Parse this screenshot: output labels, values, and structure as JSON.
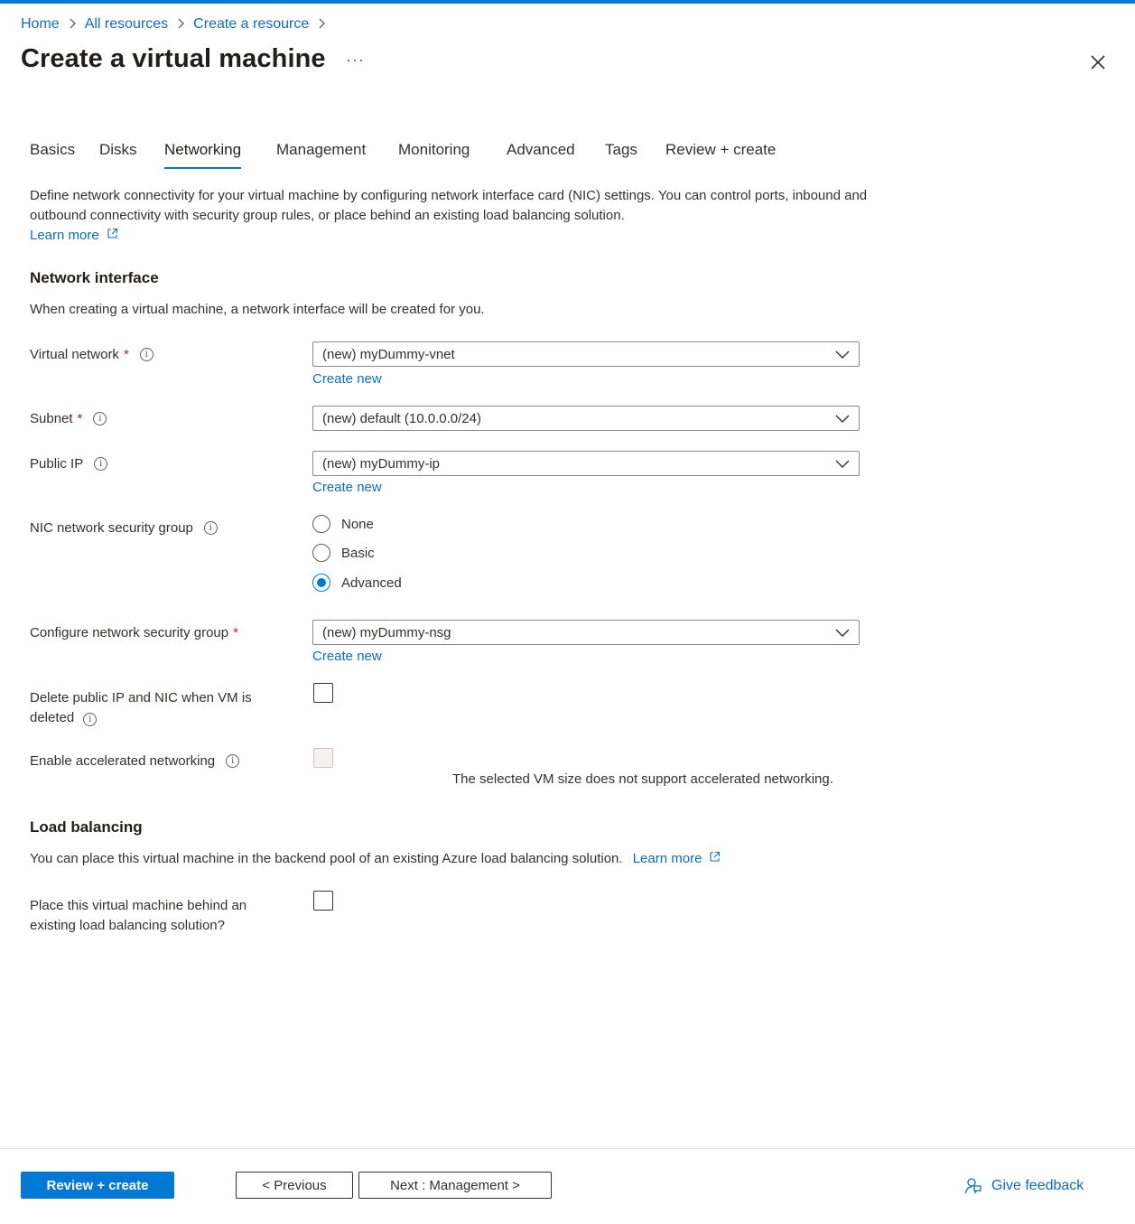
{
  "breadcrumb": [
    "Home",
    "All resources",
    "Create a resource"
  ],
  "page_title": "Create a virtual machine",
  "more_label": "···",
  "tabs": [
    "Basics",
    "Disks",
    "Networking",
    "Management",
    "Monitoring",
    "Advanced",
    "Tags",
    "Review + create"
  ],
  "active_tab": "Networking",
  "intro": {
    "text": "Define network connectivity for your virtual machine by configuring network interface card (NIC) settings. You can control ports, inbound and outbound connectivity with security group rules, or place behind an existing load balancing solution.",
    "learn_more": "Learn more"
  },
  "network_interface": {
    "heading": "Network interface",
    "description": "When creating a virtual machine, a network interface will be created for you.",
    "virtual_network": {
      "label": "Virtual network",
      "value": "(new) myDummy-vnet",
      "create_new": "Create new"
    },
    "subnet": {
      "label": "Subnet",
      "value": "(new) default (10.0.0.0/24)"
    },
    "public_ip": {
      "label": "Public IP",
      "value": "(new) myDummy-ip",
      "create_new": "Create new"
    },
    "nic_nsg": {
      "label": "NIC network security group",
      "options": [
        "None",
        "Basic",
        "Advanced"
      ],
      "selected": "Advanced"
    },
    "configure_nsg": {
      "label": "Configure network security group",
      "value": "(new) myDummy-nsg",
      "create_new": "Create new"
    },
    "delete_public_ip": {
      "label_line1": "Delete public IP and NIC when VM is",
      "label_line2": "deleted",
      "checked": false
    },
    "accelerated_networking": {
      "label": "Enable accelerated networking",
      "checked": false,
      "disabled": true,
      "note": "The selected VM size does not support accelerated networking."
    }
  },
  "load_balancing": {
    "heading": "Load balancing",
    "description": "You can place this virtual machine in the backend pool of an existing Azure load balancing solution.",
    "learn_more": "Learn more",
    "place_behind": {
      "label_line1": "Place this virtual machine behind an",
      "label_line2": "existing load balancing solution?",
      "checked": false
    }
  },
  "footer": {
    "review_create": "Review + create",
    "previous": "< Previous",
    "next": "Next : Management >",
    "give_feedback": "Give feedback"
  },
  "colors": {
    "accent": "#0078d4",
    "link": "#0f6cbd",
    "required": "#a4262c"
  }
}
